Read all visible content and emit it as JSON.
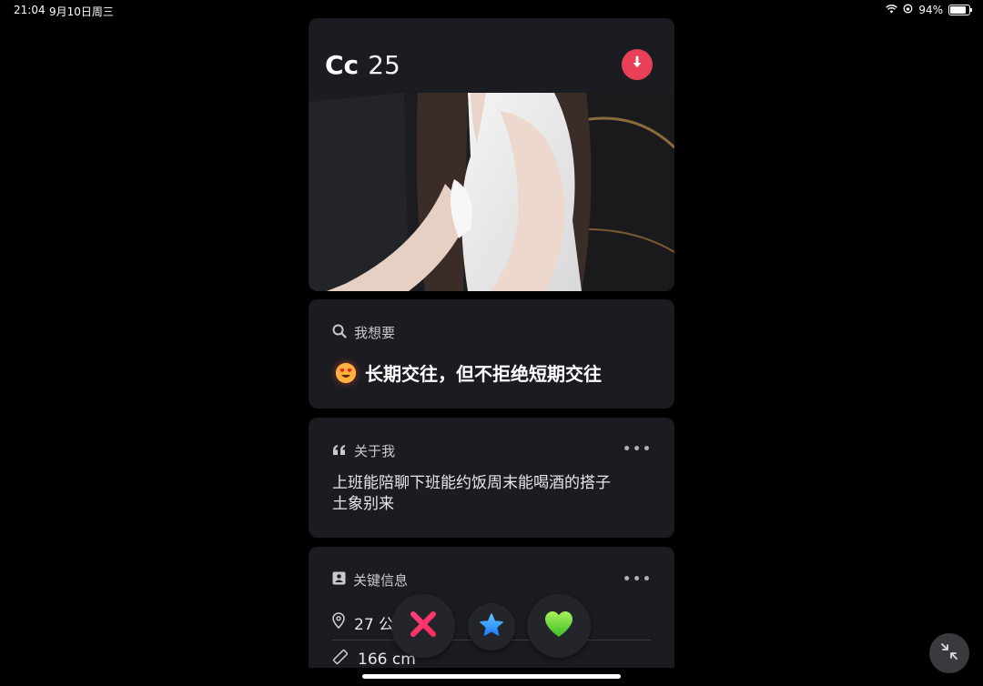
{
  "status_bar": {
    "time": "21:04",
    "date": "9月10日周三",
    "battery_text": "94%",
    "battery_level": 0.94
  },
  "profile": {
    "name": "Cc",
    "age": "25"
  },
  "looking_for": {
    "heading": "我想要",
    "value": "长期交往，但不拒绝短期交往",
    "emoji": "heart-eyes-emoji"
  },
  "about": {
    "heading": "关于我",
    "more": "•••",
    "lines": [
      "上班能陪聊下班能约饭周末能喝酒的搭子",
      "土象别来"
    ]
  },
  "key_info": {
    "heading": "关键信息",
    "more": "•••",
    "distance": "27 公",
    "height": "166 cm"
  },
  "actions": {
    "nope_icon": "close-x-icon",
    "super_like_icon": "star-icon",
    "like_icon": "heart-icon"
  },
  "colors": {
    "card_bg": "#1b1c21",
    "download_button": "#e94057",
    "nope": "#ff3f7a",
    "super_like": "#2f9bff",
    "like": "#5fd43b"
  }
}
